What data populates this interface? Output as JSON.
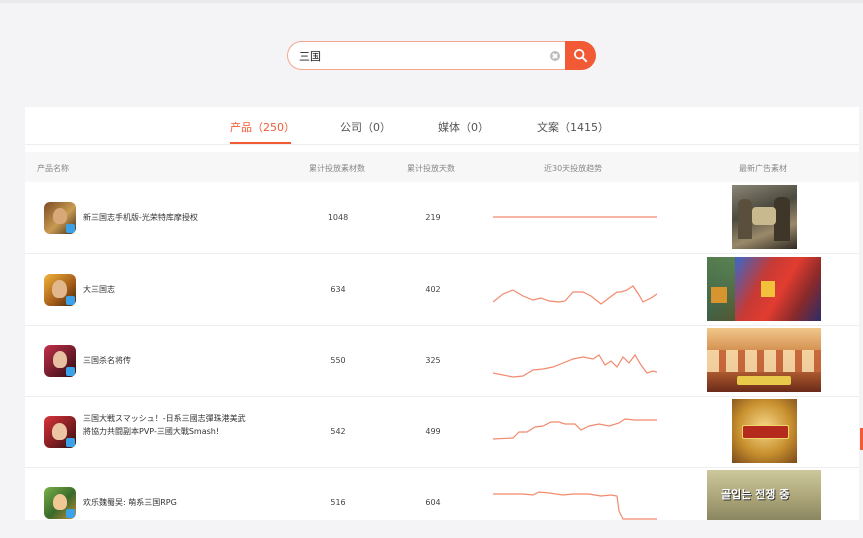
{
  "search": {
    "value": "三国"
  },
  "tabs": [
    {
      "label": "产品（250）"
    },
    {
      "label": "公司（0）"
    },
    {
      "label": "媒体（0）"
    },
    {
      "label": "文案（1415）"
    }
  ],
  "table": {
    "headers": [
      "产品名称",
      "累计投放素材数",
      "累计投放天数",
      "近30天投放趋势",
      "最新广告素材"
    ],
    "rows": [
      {
        "name": "新三国志手机版-光荣特库摩授权",
        "materials": "1048",
        "days": "219"
      },
      {
        "name": "大三国志",
        "materials": "634",
        "days": "402"
      },
      {
        "name": "三国杀名将传",
        "materials": "550",
        "days": "325"
      },
      {
        "name": "三国大戦スマッシュ！-日系三國志彈珠港美武將協力共闘副本PVP-三國大戰Smash!",
        "materials": "542",
        "days": "499"
      },
      {
        "name": "欢乐魏蜀吴: 萌系三国RPG",
        "materials": "516",
        "days": "604"
      }
    ]
  },
  "thumb_text": {
    "row4": "골입는 전쟁 중"
  },
  "colors": {
    "accent": "#f25a35",
    "trend_line": "#f28a6e"
  }
}
